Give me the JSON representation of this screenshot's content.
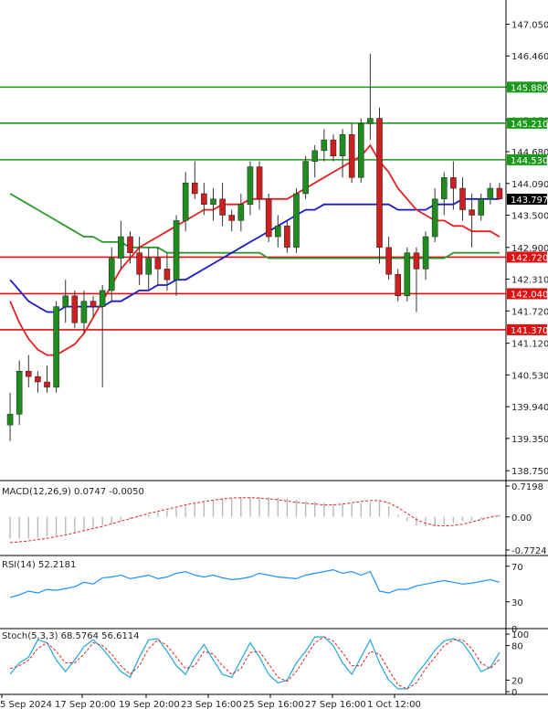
{
  "chart_data": [
    {
      "type": "candlestick",
      "panel": "price",
      "y_axis_labels": [
        "147.050",
        "146.460",
        "145.880",
        "145.270",
        "144.680",
        "144.090",
        "143.797",
        "143.500",
        "142.900",
        "142.310",
        "141.720",
        "141.120",
        "140.530",
        "139.940",
        "139.350",
        "138.750"
      ],
      "ylim": [
        138.6,
        147.5
      ],
      "current_price": {
        "value": 143.797,
        "label": "143.797",
        "color": "#000000"
      },
      "horizontal_levels": [
        {
          "value": 145.88,
          "label": "145.880",
          "color": "#1a9a1a",
          "role": "resistance"
        },
        {
          "value": 145.21,
          "label": "145.210",
          "color": "#1a9a1a",
          "role": "resistance"
        },
        {
          "value": 144.53,
          "label": "144.530",
          "color": "#1a9a1a",
          "role": "resistance"
        },
        {
          "value": 142.72,
          "label": "142.720",
          "color": "#e01010",
          "role": "support"
        },
        {
          "value": 142.04,
          "label": "142.040",
          "color": "#e01010",
          "role": "support"
        },
        {
          "value": 141.37,
          "label": "141.370",
          "color": "#e01010",
          "role": "support"
        }
      ],
      "candles": [
        [
          139.6,
          140.2,
          139.3,
          139.8
        ],
        [
          139.8,
          140.8,
          139.6,
          140.6
        ],
        [
          140.6,
          140.9,
          140.3,
          140.5
        ],
        [
          140.5,
          140.6,
          140.2,
          140.4
        ],
        [
          140.4,
          140.7,
          140.2,
          140.3
        ],
        [
          140.3,
          141.9,
          140.2,
          141.8
        ],
        [
          141.8,
          142.3,
          141.5,
          142.0
        ],
        [
          142.0,
          142.1,
          141.4,
          141.5
        ],
        [
          141.5,
          142.1,
          141.3,
          141.9
        ],
        [
          141.9,
          142.0,
          141.6,
          141.8
        ],
        [
          141.8,
          142.2,
          140.3,
          142.1
        ],
        [
          142.1,
          142.9,
          141.9,
          142.7
        ],
        [
          142.7,
          143.4,
          142.5,
          143.1
        ],
        [
          143.1,
          143.2,
          142.6,
          142.8
        ],
        [
          142.8,
          143.1,
          142.2,
          142.4
        ],
        [
          142.4,
          142.9,
          142.1,
          142.7
        ],
        [
          142.7,
          142.9,
          142.2,
          142.5
        ],
        [
          142.5,
          142.8,
          142.1,
          142.3
        ],
        [
          142.3,
          143.5,
          142.0,
          143.4
        ],
        [
          143.4,
          144.3,
          143.2,
          144.1
        ],
        [
          144.1,
          144.5,
          143.8,
          143.9
        ],
        [
          143.9,
          144.1,
          143.5,
          143.7
        ],
        [
          143.7,
          144.0,
          143.4,
          143.8
        ],
        [
          143.8,
          144.1,
          143.3,
          143.5
        ],
        [
          143.5,
          143.6,
          143.2,
          143.4
        ],
        [
          143.4,
          143.9,
          143.2,
          143.7
        ],
        [
          143.7,
          144.5,
          143.5,
          144.4
        ],
        [
          144.4,
          144.5,
          143.6,
          143.8
        ],
        [
          143.8,
          143.9,
          143.0,
          143.1
        ],
        [
          143.1,
          143.5,
          142.9,
          143.3
        ],
        [
          143.3,
          143.4,
          142.8,
          142.9
        ],
        [
          142.9,
          144.0,
          142.8,
          143.9
        ],
        [
          143.9,
          144.6,
          143.8,
          144.5
        ],
        [
          144.5,
          144.8,
          144.2,
          144.7
        ],
        [
          144.7,
          145.1,
          144.5,
          144.9
        ],
        [
          144.9,
          145.0,
          144.5,
          144.6
        ],
        [
          144.6,
          145.1,
          144.2,
          145.0
        ],
        [
          145.0,
          145.2,
          144.1,
          144.2
        ],
        [
          144.2,
          145.3,
          144.1,
          145.2
        ],
        [
          145.2,
          146.5,
          144.9,
          145.3
        ],
        [
          145.3,
          145.5,
          142.6,
          142.9
        ],
        [
          142.9,
          143.1,
          142.3,
          142.4
        ],
        [
          142.4,
          142.5,
          141.9,
          142.0
        ],
        [
          142.0,
          142.9,
          141.9,
          142.8
        ],
        [
          142.8,
          142.9,
          141.7,
          142.5
        ],
        [
          142.5,
          143.2,
          142.3,
          143.1
        ],
        [
          143.1,
          144.0,
          143.0,
          143.8
        ],
        [
          143.8,
          144.3,
          143.5,
          144.2
        ],
        [
          144.2,
          144.5,
          143.6,
          144.0
        ],
        [
          144.0,
          144.2,
          143.4,
          143.6
        ],
        [
          143.6,
          143.9,
          142.9,
          143.5
        ],
        [
          143.5,
          143.9,
          143.4,
          143.8
        ],
        [
          143.8,
          144.1,
          143.7,
          144.0
        ],
        [
          144.0,
          144.1,
          143.8,
          143.8
        ]
      ],
      "ma_red": [
        141.9,
        141.5,
        141.2,
        141.0,
        140.9,
        140.9,
        141.0,
        141.1,
        141.3,
        141.6,
        141.9,
        142.2,
        142.5,
        142.7,
        142.9,
        143.0,
        143.1,
        143.2,
        143.3,
        143.4,
        143.5,
        143.6,
        143.6,
        143.7,
        143.7,
        143.7,
        143.8,
        143.8,
        143.8,
        143.8,
        143.8,
        143.9,
        144.0,
        144.1,
        144.2,
        144.3,
        144.4,
        144.5,
        144.6,
        144.8,
        144.5,
        144.3,
        144.0,
        143.8,
        143.6,
        143.5,
        143.4,
        143.4,
        143.3,
        143.3,
        143.2,
        143.2,
        143.2,
        143.1
      ],
      "ma_blue": [
        142.3,
        142.1,
        141.9,
        141.8,
        141.7,
        141.7,
        141.8,
        141.8,
        141.8,
        141.8,
        141.8,
        141.9,
        141.9,
        142.0,
        142.1,
        142.1,
        142.2,
        142.2,
        142.3,
        142.3,
        142.4,
        142.5,
        142.6,
        142.7,
        142.8,
        142.9,
        143.0,
        143.1,
        143.2,
        143.3,
        143.4,
        143.5,
        143.6,
        143.6,
        143.7,
        143.7,
        143.7,
        143.7,
        143.7,
        143.7,
        143.7,
        143.7,
        143.6,
        143.6,
        143.6,
        143.6,
        143.7,
        143.7,
        143.7,
        143.8,
        143.8,
        143.8,
        143.8,
        143.8
      ],
      "ma_green": [
        143.9,
        143.8,
        143.7,
        143.6,
        143.5,
        143.4,
        143.3,
        143.2,
        143.1,
        143.1,
        143.0,
        143.0,
        143.0,
        142.9,
        142.9,
        142.9,
        142.9,
        142.8,
        142.8,
        142.8,
        142.8,
        142.8,
        142.8,
        142.8,
        142.8,
        142.8,
        142.8,
        142.8,
        142.7,
        142.7,
        142.7,
        142.7,
        142.7,
        142.7,
        142.7,
        142.7,
        142.7,
        142.7,
        142.7,
        142.7,
        142.7,
        142.7,
        142.7,
        142.7,
        142.7,
        142.7,
        142.7,
        142.7,
        142.8,
        142.8,
        142.8,
        142.8,
        142.8,
        142.8
      ],
      "x_tick_labels": [
        "5 Sep 2024",
        "17 Sep 20:00",
        "19 Sep 20:00",
        "23 Sep 16:00",
        "25 Sep 16:00",
        "27 Sep 16:00",
        "1 Oct 12:00"
      ]
    },
    {
      "type": "bar",
      "panel": "macd",
      "label": "MACD(12,26,9) 0.0747 -0.0050",
      "y_axis_labels": [
        "0.7198",
        "0.00",
        "-0.7724"
      ],
      "ylim": [
        -0.7724,
        0.7198
      ],
      "histogram": [
        -0.5,
        -0.5,
        -0.5,
        -0.48,
        -0.46,
        -0.44,
        -0.4,
        -0.35,
        -0.3,
        -0.25,
        -0.2,
        -0.15,
        -0.1,
        -0.05,
        0.0,
        0.05,
        0.1,
        0.15,
        0.2,
        0.25,
        0.3,
        0.34,
        0.38,
        0.42,
        0.45,
        0.46,
        0.47,
        0.47,
        0.46,
        0.45,
        0.43,
        0.4,
        0.37,
        0.35,
        0.33,
        0.31,
        0.3,
        0.31,
        0.32,
        0.34,
        0.36,
        0.25,
        0.05,
        -0.1,
        -0.2,
        -0.22,
        -0.22,
        -0.18,
        -0.14,
        -0.1,
        -0.08,
        -0.05,
        0.0,
        0.05
      ],
      "signal": [
        -0.6,
        -0.58,
        -0.56,
        -0.53,
        -0.5,
        -0.46,
        -0.42,
        -0.37,
        -0.32,
        -0.27,
        -0.22,
        -0.16,
        -0.1,
        -0.04,
        0.02,
        0.08,
        0.13,
        0.18,
        0.23,
        0.28,
        0.32,
        0.36,
        0.39,
        0.42,
        0.44,
        0.45,
        0.45,
        0.44,
        0.42,
        0.4,
        0.37,
        0.34,
        0.32,
        0.3,
        0.28,
        0.28,
        0.3,
        0.33,
        0.36,
        0.38,
        0.38,
        0.33,
        0.22,
        0.08,
        -0.06,
        -0.15,
        -0.2,
        -0.21,
        -0.2,
        -0.17,
        -0.12,
        -0.06,
        0.0,
        0.03
      ]
    },
    {
      "type": "line",
      "panel": "rsi",
      "label": "RSI(14) 52.2181",
      "y_axis_labels": [
        "70",
        "30",
        "0"
      ],
      "ylim": [
        0,
        80
      ],
      "series": [
        {
          "values": [
            35,
            38,
            42,
            40,
            44,
            43,
            45,
            47,
            52,
            50,
            57,
            58,
            60,
            56,
            58,
            60,
            56,
            58,
            62,
            64,
            60,
            58,
            60,
            57,
            55,
            56,
            58,
            62,
            60,
            58,
            57,
            56,
            60,
            62,
            64,
            66,
            62,
            64,
            60,
            64,
            42,
            40,
            44,
            44,
            48,
            50,
            52,
            54,
            52,
            50,
            51,
            53,
            55,
            52
          ]
        }
      ]
    },
    {
      "type": "line",
      "panel": "stochastic",
      "label": "Stoch(5,3,3) 68.5764 56.6114",
      "y_axis_labels": [
        "100",
        "80",
        "20",
        "0"
      ],
      "ylim": [
        0,
        100
      ],
      "series": [
        {
          "values": [
            30,
            50,
            60,
            90,
            85,
            55,
            35,
            55,
            78,
            90,
            75,
            55,
            35,
            25,
            60,
            90,
            92,
            70,
            45,
            30,
            60,
            82,
            55,
            30,
            25,
            55,
            85,
            60,
            30,
            15,
            20,
            50,
            70,
            95,
            95,
            80,
            50,
            30,
            60,
            90,
            50,
            20,
            5,
            5,
            30,
            50,
            72,
            88,
            92,
            85,
            62,
            35,
            42,
            68
          ]
        },
        {
          "values": [
            40,
            45,
            55,
            75,
            85,
            70,
            50,
            50,
            65,
            85,
            80,
            65,
            45,
            30,
            45,
            75,
            90,
            80,
            60,
            40,
            45,
            70,
            65,
            45,
            30,
            40,
            68,
            70,
            48,
            25,
            18,
            35,
            60,
            85,
            95,
            88,
            68,
            45,
            45,
            70,
            65,
            38,
            12,
            5,
            15,
            40,
            60,
            80,
            90,
            90,
            75,
            50,
            40,
            56
          ]
        }
      ]
    }
  ]
}
